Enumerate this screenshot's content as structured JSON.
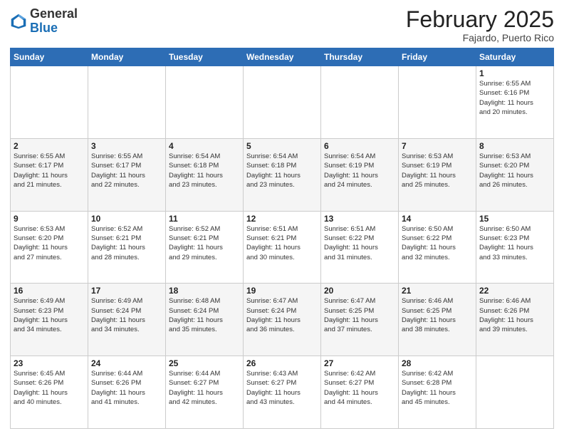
{
  "header": {
    "logo_general": "General",
    "logo_blue": "Blue",
    "month_title": "February 2025",
    "location": "Fajardo, Puerto Rico"
  },
  "days_of_week": [
    "Sunday",
    "Monday",
    "Tuesday",
    "Wednesday",
    "Thursday",
    "Friday",
    "Saturday"
  ],
  "weeks": [
    [
      {
        "day": "",
        "info": ""
      },
      {
        "day": "",
        "info": ""
      },
      {
        "day": "",
        "info": ""
      },
      {
        "day": "",
        "info": ""
      },
      {
        "day": "",
        "info": ""
      },
      {
        "day": "",
        "info": ""
      },
      {
        "day": "1",
        "info": "Sunrise: 6:55 AM\nSunset: 6:16 PM\nDaylight: 11 hours\nand 20 minutes."
      }
    ],
    [
      {
        "day": "2",
        "info": "Sunrise: 6:55 AM\nSunset: 6:17 PM\nDaylight: 11 hours\nand 21 minutes."
      },
      {
        "day": "3",
        "info": "Sunrise: 6:55 AM\nSunset: 6:17 PM\nDaylight: 11 hours\nand 22 minutes."
      },
      {
        "day": "4",
        "info": "Sunrise: 6:54 AM\nSunset: 6:18 PM\nDaylight: 11 hours\nand 23 minutes."
      },
      {
        "day": "5",
        "info": "Sunrise: 6:54 AM\nSunset: 6:18 PM\nDaylight: 11 hours\nand 23 minutes."
      },
      {
        "day": "6",
        "info": "Sunrise: 6:54 AM\nSunset: 6:19 PM\nDaylight: 11 hours\nand 24 minutes."
      },
      {
        "day": "7",
        "info": "Sunrise: 6:53 AM\nSunset: 6:19 PM\nDaylight: 11 hours\nand 25 minutes."
      },
      {
        "day": "8",
        "info": "Sunrise: 6:53 AM\nSunset: 6:20 PM\nDaylight: 11 hours\nand 26 minutes."
      }
    ],
    [
      {
        "day": "9",
        "info": "Sunrise: 6:53 AM\nSunset: 6:20 PM\nDaylight: 11 hours\nand 27 minutes."
      },
      {
        "day": "10",
        "info": "Sunrise: 6:52 AM\nSunset: 6:21 PM\nDaylight: 11 hours\nand 28 minutes."
      },
      {
        "day": "11",
        "info": "Sunrise: 6:52 AM\nSunset: 6:21 PM\nDaylight: 11 hours\nand 29 minutes."
      },
      {
        "day": "12",
        "info": "Sunrise: 6:51 AM\nSunset: 6:21 PM\nDaylight: 11 hours\nand 30 minutes."
      },
      {
        "day": "13",
        "info": "Sunrise: 6:51 AM\nSunset: 6:22 PM\nDaylight: 11 hours\nand 31 minutes."
      },
      {
        "day": "14",
        "info": "Sunrise: 6:50 AM\nSunset: 6:22 PM\nDaylight: 11 hours\nand 32 minutes."
      },
      {
        "day": "15",
        "info": "Sunrise: 6:50 AM\nSunset: 6:23 PM\nDaylight: 11 hours\nand 33 minutes."
      }
    ],
    [
      {
        "day": "16",
        "info": "Sunrise: 6:49 AM\nSunset: 6:23 PM\nDaylight: 11 hours\nand 34 minutes."
      },
      {
        "day": "17",
        "info": "Sunrise: 6:49 AM\nSunset: 6:24 PM\nDaylight: 11 hours\nand 34 minutes."
      },
      {
        "day": "18",
        "info": "Sunrise: 6:48 AM\nSunset: 6:24 PM\nDaylight: 11 hours\nand 35 minutes."
      },
      {
        "day": "19",
        "info": "Sunrise: 6:47 AM\nSunset: 6:24 PM\nDaylight: 11 hours\nand 36 minutes."
      },
      {
        "day": "20",
        "info": "Sunrise: 6:47 AM\nSunset: 6:25 PM\nDaylight: 11 hours\nand 37 minutes."
      },
      {
        "day": "21",
        "info": "Sunrise: 6:46 AM\nSunset: 6:25 PM\nDaylight: 11 hours\nand 38 minutes."
      },
      {
        "day": "22",
        "info": "Sunrise: 6:46 AM\nSunset: 6:26 PM\nDaylight: 11 hours\nand 39 minutes."
      }
    ],
    [
      {
        "day": "23",
        "info": "Sunrise: 6:45 AM\nSunset: 6:26 PM\nDaylight: 11 hours\nand 40 minutes."
      },
      {
        "day": "24",
        "info": "Sunrise: 6:44 AM\nSunset: 6:26 PM\nDaylight: 11 hours\nand 41 minutes."
      },
      {
        "day": "25",
        "info": "Sunrise: 6:44 AM\nSunset: 6:27 PM\nDaylight: 11 hours\nand 42 minutes."
      },
      {
        "day": "26",
        "info": "Sunrise: 6:43 AM\nSunset: 6:27 PM\nDaylight: 11 hours\nand 43 minutes."
      },
      {
        "day": "27",
        "info": "Sunrise: 6:42 AM\nSunset: 6:27 PM\nDaylight: 11 hours\nand 44 minutes."
      },
      {
        "day": "28",
        "info": "Sunrise: 6:42 AM\nSunset: 6:28 PM\nDaylight: 11 hours\nand 45 minutes."
      },
      {
        "day": "",
        "info": ""
      }
    ]
  ]
}
